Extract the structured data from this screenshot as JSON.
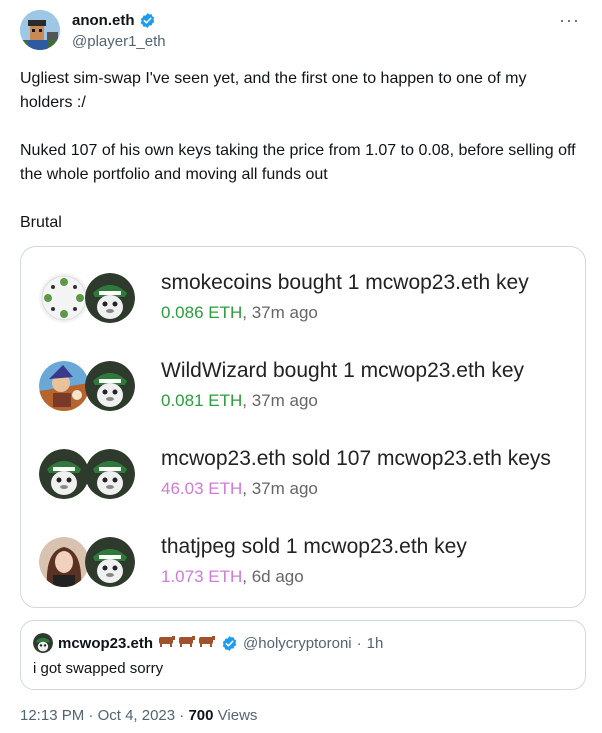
{
  "author": {
    "display_name": "anon.eth",
    "handle": "@player1_eth"
  },
  "more_label": "···",
  "tweet": {
    "paragraphs": [
      "Ugliest sim-swap I've seen yet, and the first one to happen to one of my holders :/",
      "Nuked 107 of his own keys taking the price from 1.07 to 0.08, before selling off the whole portfolio and moving all funds out",
      "Brutal"
    ]
  },
  "trades": [
    {
      "action": "smokecoins bought 1 mcwop23.eth key",
      "price": "0.086 ETH",
      "time": ", 37m ago",
      "side": "buy"
    },
    {
      "action": "WildWizard bought 1 mcwop23.eth key",
      "price": "0.081 ETH",
      "time": ", 37m ago",
      "side": "buy"
    },
    {
      "action": "mcwop23.eth sold 107 mcwop23.eth keys",
      "price": "46.03 ETH",
      "time": ", 37m ago",
      "side": "sell"
    },
    {
      "action": "thatjpeg sold 1 mcwop23.eth key",
      "price": "1.073 ETH",
      "time": ", 6d ago",
      "side": "sell"
    }
  ],
  "quote": {
    "name": "mcwop23.eth",
    "handle": "@holycryptoroni",
    "separator": "·",
    "time": "1h",
    "text": "i got swapped sorry"
  },
  "meta": {
    "time": "12:13 PM",
    "dot1": "·",
    "date": "Oct 4, 2023",
    "dot2": "·",
    "views_count": "700",
    "views_label": "Views"
  },
  "colors": {
    "verified": "#1d9bf0",
    "buy_price": "#2a9d3c",
    "sell_price": "#d17ad8"
  }
}
